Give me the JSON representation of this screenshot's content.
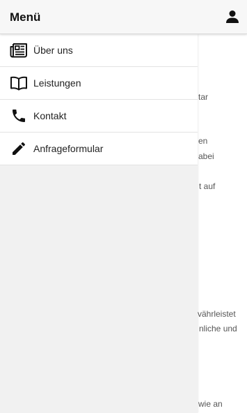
{
  "header": {
    "title": "Menü",
    "user_icon": "user-icon"
  },
  "menu": {
    "items": [
      {
        "label": "Über uns",
        "icon": "newspaper-icon"
      },
      {
        "label": "Leistungen",
        "icon": "book-open-icon"
      },
      {
        "label": "Kontakt",
        "icon": "phone-icon"
      },
      {
        "label": "Anfrageformular",
        "icon": "pencil-icon"
      }
    ]
  },
  "background_text": {
    "lines": [
      "tar",
      "en",
      "abei",
      "t auf",
      "vährleistet",
      "nliche und",
      "wie an"
    ]
  },
  "colors": {
    "header_bg": "#f7f7f7",
    "drawer_bg": "#f1f1f1",
    "text": "#222222"
  }
}
